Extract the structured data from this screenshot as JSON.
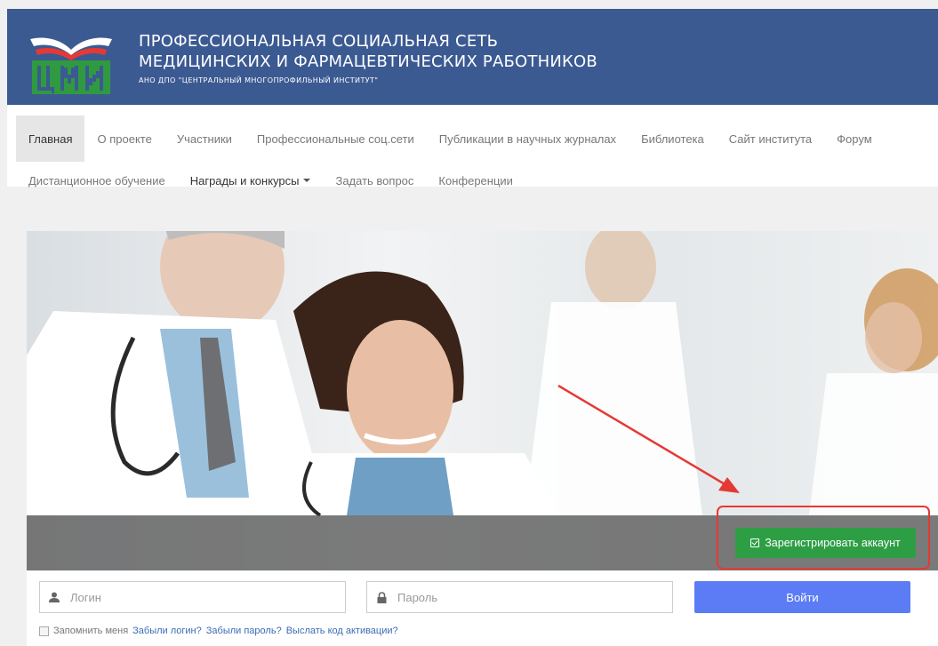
{
  "header": {
    "title_line1": "ПРОФЕССИОНАЛЬНАЯ СОЦИАЛЬНАЯ СЕТЬ",
    "title_line2": "МЕДИЦИНСКИХ И ФАРМАЦЕВТИЧЕСКИХ РАБОТНИКОВ",
    "subtitle": "АНО ДПО \"ЦЕНТРАЛЬНЫЙ МНОГОПРОФИЛЬНЫЙ ИНСТИТУТ\"",
    "logo_text": "ЦМИ",
    "bg_color": "#3c5a92"
  },
  "nav": {
    "row1": [
      {
        "label": "Главная",
        "active": true
      },
      {
        "label": "О проекте"
      },
      {
        "label": "Участники"
      },
      {
        "label": "Профессиональные соц.сети"
      },
      {
        "label": "Публикации в научных журналах"
      },
      {
        "label": "Библиотека"
      },
      {
        "label": "Сайт института"
      },
      {
        "label": "Форум"
      }
    ],
    "row2": [
      {
        "label": "Дистанционное обучение"
      },
      {
        "label": "Награды и конкурсы",
        "dropdown": true
      },
      {
        "label": "Задать вопрос"
      },
      {
        "label": "Конференции"
      }
    ]
  },
  "hero": {
    "register_label": "Зарегистрировать аккаунт",
    "register_icon": "calendar-check-icon",
    "register_color": "#2e9e45",
    "annotation_color": "#e53935"
  },
  "login": {
    "login_placeholder": "Логин",
    "login_icon": "user-icon",
    "password_placeholder": "Пароль",
    "password_icon": "lock-icon",
    "submit_label": "Войти",
    "submit_color": "#5b7cf5",
    "remember_label": "Запомнить меня",
    "forgot_login": "Забыли логин?",
    "forgot_password": "Забыли пароль?",
    "resend_code": "Выслать код активации?"
  }
}
